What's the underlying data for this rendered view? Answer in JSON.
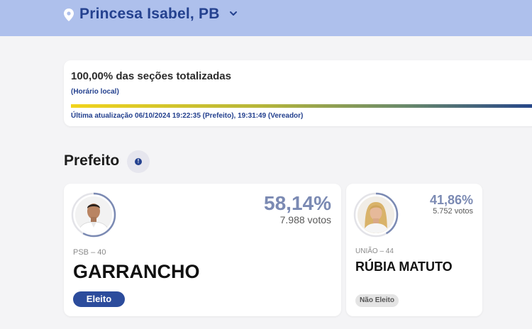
{
  "location": {
    "title": "Princesa Isabel, PB",
    "pin_icon": "location-pin-icon",
    "chevron_icon": "chevron-down-icon"
  },
  "status": {
    "title": "100,00% das seções totalizadas",
    "subtitle": "(Horário local)",
    "progress": 1.0,
    "last_update": "Última atualização 06/10/2024 19:22:35 (Prefeito), 19:31:49 (Vereador)"
  },
  "section": {
    "title": "Prefeito",
    "info_icon": "info-icon"
  },
  "colors": {
    "accent": "#24418f",
    "topbar": "#aec0ec",
    "percent": "#7b8ab3",
    "elected": "#2c4c9c"
  },
  "candidates": [
    {
      "party": "PSB – 40",
      "name": "GARRANCHO",
      "percent": "58,14%",
      "votes": "7.988 votos",
      "status": "Eleito",
      "vote_share": 0.5814
    },
    {
      "party": "UNIÃO – 44",
      "name": "RÚBIA MATUTO",
      "percent": "41,86%",
      "votes": "5.752 votos",
      "status": "Não Eleito",
      "vote_share": 0.4186
    }
  ]
}
